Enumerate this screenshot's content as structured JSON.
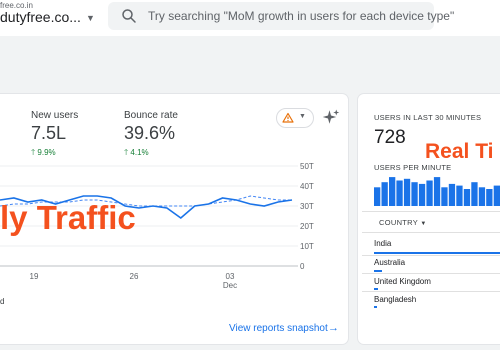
{
  "account": {
    "subtitle": "free.co.in",
    "name": "dutyfree.co..."
  },
  "search": {
    "placeholder": "Try searching \"MoM growth in users for each device type\""
  },
  "metrics": [
    {
      "label": "New users",
      "value": "7.5L",
      "delta": "9.9%"
    },
    {
      "label": "Bounce rate",
      "value": "39.6%",
      "delta": "4.1%"
    }
  ],
  "overlays": {
    "traffic": "ly Traffic",
    "realtime": "Real Ti"
  },
  "chart_data": {
    "type": "line",
    "x_tick_labels": [
      "19",
      "26",
      "03"
    ],
    "x_sub_label": "Dec",
    "y_tick_labels": [
      "50T",
      "40T",
      "30T",
      "20T",
      "10T",
      "0"
    ],
    "ylim": [
      0,
      50
    ],
    "legend_fragment": "d",
    "series": [
      {
        "style": "solid",
        "color": "#1a73e8",
        "values": [
          33,
          34,
          32,
          33,
          31,
          33,
          35,
          35,
          34,
          30,
          29,
          30,
          29,
          24,
          30,
          31,
          34,
          33,
          31,
          30,
          32,
          33
        ]
      },
      {
        "style": "dashed",
        "color": "#4285f4",
        "values": [
          30,
          31,
          31,
          32,
          32,
          32,
          33,
          33,
          32,
          31,
          30,
          30,
          30,
          30,
          30,
          31,
          32,
          33,
          35,
          34,
          33,
          33
        ]
      }
    ]
  },
  "links": {
    "snapshot": "View reports snapshot"
  },
  "realtime": {
    "header": "USERS IN LAST 30 MINUTES",
    "value": "728",
    "per_minute_label": "USERS PER MINUTE",
    "bars": [
      0.55,
      0.7,
      0.85,
      0.75,
      0.8,
      0.7,
      0.65,
      0.75,
      0.85,
      0.55,
      0.65,
      0.6,
      0.5,
      0.7,
      0.55,
      0.5,
      0.6
    ],
    "country_header": "COUNTRY",
    "countries": [
      {
        "name": "India",
        "share": 1.0
      },
      {
        "name": "Australia",
        "share": 0.06
      },
      {
        "name": "United Kingdom",
        "share": 0.03
      },
      {
        "name": "Bangladesh",
        "share": 0.02
      }
    ]
  },
  "colors": {
    "accent": "#1a73e8",
    "positive": "#188038",
    "overlay": "#f4511e",
    "warning": "#e8710a"
  }
}
